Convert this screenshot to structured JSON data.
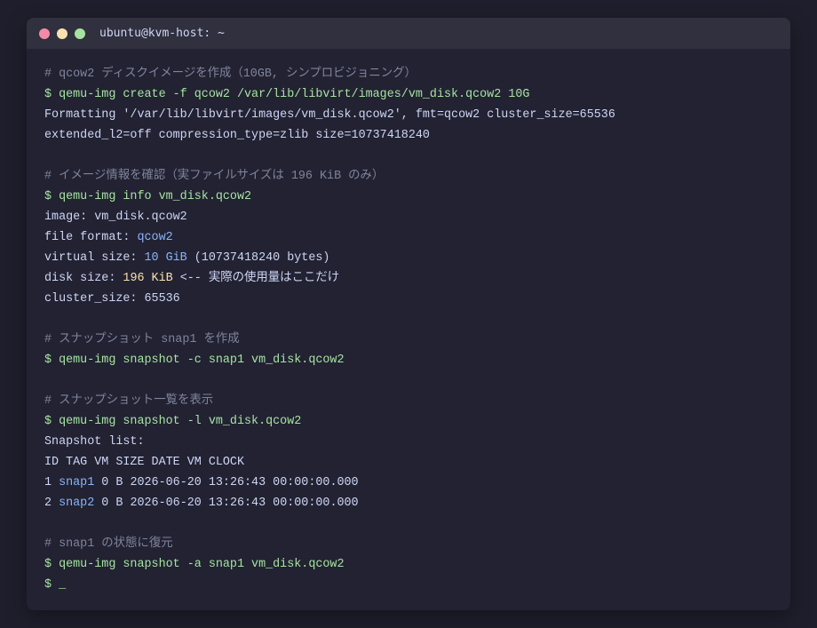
{
  "window": {
    "title": "ubuntu@kvm-host: ~"
  },
  "terminal": {
    "l1": "# qcow2 ディスクイメージを作成（10GB, シンプロビジョニング）",
    "l2": "$ qemu-img create -f qcow2 /var/lib/libvirt/images/vm_disk.qcow2 10G",
    "l3": "Formatting '/var/lib/libvirt/images/vm_disk.qcow2', fmt=qcow2 cluster_size=65536",
    "l4": "extended_l2=off compression_type=zlib size=10737418240",
    "l5": "# イメージ情報を確認（実ファイルサイズは 196 KiB のみ）",
    "l6": "$ qemu-img info vm_disk.qcow2",
    "l7": "image: vm_disk.qcow2",
    "l8_label": "file format: ",
    "l8_value": "qcow2",
    "l9_label": "virtual size: ",
    "l9_value": "10 GiB",
    "l9_rest": " (10737418240 bytes)",
    "l10_label": "disk size: ",
    "l10_value": "196 KiB",
    "l10_rest": " <-- 実際の使用量はここだけ",
    "l11": "cluster_size: 65536",
    "l12": "# スナップショット snap1 を作成",
    "l13": "$ qemu-img snapshot -c snap1 vm_disk.qcow2",
    "l14": "# スナップショット一覧を表示",
    "l15": "$ qemu-img snapshot -l vm_disk.qcow2",
    "l16": "Snapshot list:",
    "l17": "ID TAG VM SIZE DATE VM CLOCK",
    "l18_id": "1 ",
    "l18_tag": "snap1",
    "l18_rest": " 0 B 2026-06-20 13:26:43 00:00:00.000",
    "l19_id": "2 ",
    "l19_tag": "snap2",
    "l19_rest": " 0 B 2026-06-20 13:26:43 00:00:00.000",
    "l20": "# snap1 の状態に復元",
    "l21": "$ qemu-img snapshot -a snap1 vm_disk.qcow2",
    "l22": "$ _"
  }
}
